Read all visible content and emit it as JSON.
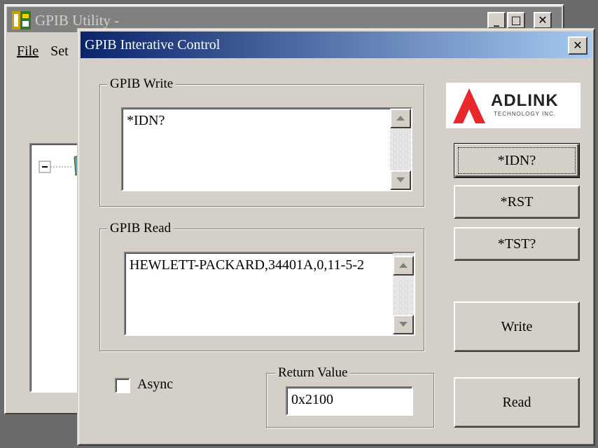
{
  "back_window": {
    "title": "GPIB Utility -",
    "menu": [
      "File",
      "Set"
    ],
    "caption_buttons": {
      "minimize": "_",
      "maximize": "□",
      "close": "✕"
    }
  },
  "dialog": {
    "title": "GPIB Interative Control",
    "close_label": "✕",
    "write_group": {
      "label": "GPIB Write",
      "value": "*IDN?"
    },
    "read_group": {
      "label": "GPIB Read",
      "value": "HEWLETT-PACKARD,34401A,0,11-5-2"
    },
    "logo": {
      "brand": "ADLINK",
      "tagline": "TECHNOLOGY INC.",
      "color": "#e8282a"
    },
    "buttons": {
      "idn": "*IDN?",
      "rst": "*RST",
      "tst": "*TST?",
      "write": "Write",
      "read": "Read"
    },
    "async": {
      "label": "Async",
      "checked": false
    },
    "return_value": {
      "label": "Return Value",
      "value": "0x2100"
    }
  },
  "colors": {
    "face": "#d4d0c8",
    "title_active_start": "#0a246a",
    "title_active_end": "#a6caf0",
    "title_inactive": "#808080"
  }
}
